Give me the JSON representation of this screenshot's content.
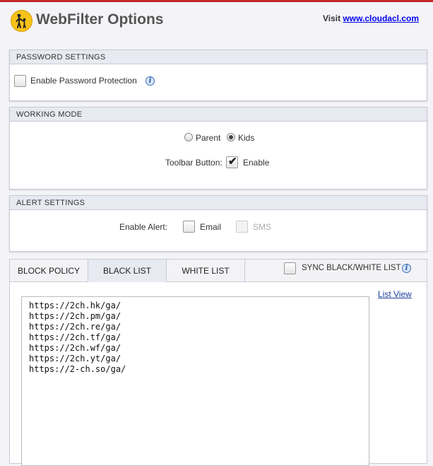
{
  "header": {
    "title": "WebFilter Options",
    "visit_text": "Visit",
    "visit_link": "www.cloudacl.com",
    "logo_icon": "family-walking-icon",
    "accent_color": "#c0272d"
  },
  "password_settings": {
    "heading": "PASSWORD SETTINGS",
    "enable_label": "Enable Password Protection",
    "enabled": false
  },
  "working_mode": {
    "heading": "WORKING MODE",
    "options": [
      "Parent",
      "Kids"
    ],
    "selected": "Kids",
    "toolbar_label": "Toolbar Button:",
    "toolbar_enable_label": "Enable",
    "toolbar_enabled": true
  },
  "alert_settings": {
    "heading": "ALERT SETTINGS",
    "label": "Enable Alert:",
    "email_label": "Email",
    "sms_label": "SMS",
    "email_checked": false,
    "sms_enabled": false
  },
  "policy_tabs": {
    "tabs": [
      "BLOCK POLICY",
      "BLACK LIST",
      "WHITE LIST"
    ],
    "active_tab": "BLACK LIST",
    "sync_label": "SYNC BLACK/WHITE LIST",
    "sync_checked": false,
    "list_view_label": "List View",
    "black_list": [
      "https://2ch.hk/ga/",
      "https://2ch.pm/ga/",
      "https://2ch.re/ga/",
      "https://2ch.tf/ga/",
      "https://2ch.wf/ga/",
      "https://2ch.yt/ga/",
      "https://2-ch.so/ga/"
    ]
  }
}
